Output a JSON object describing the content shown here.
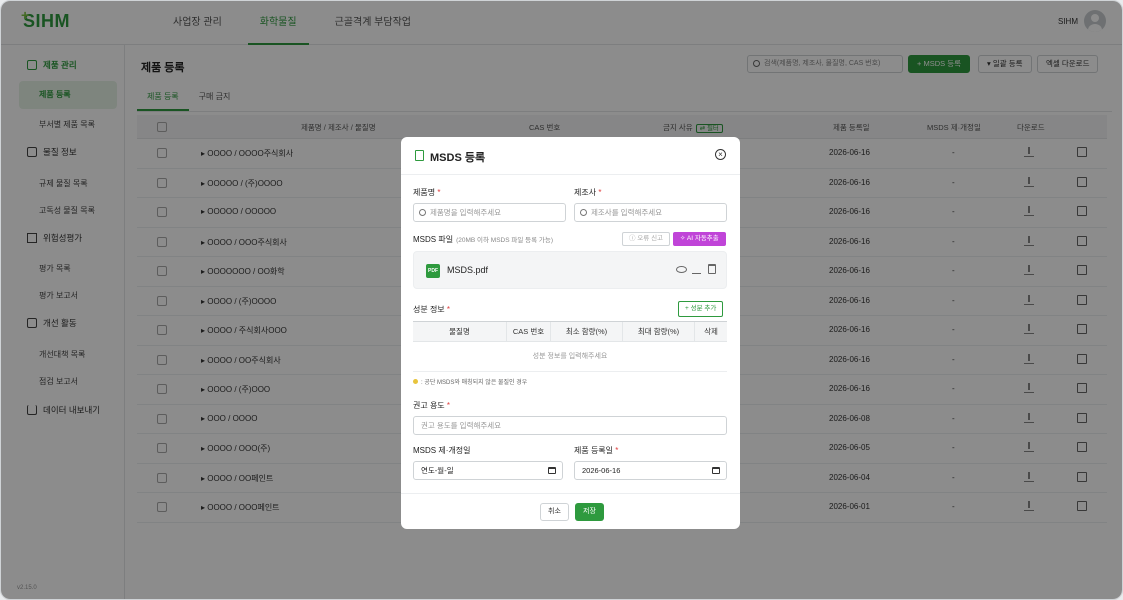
{
  "app": {
    "logo": "SIHM",
    "version": "v2.15.0"
  },
  "topnav": [
    "사업장 관리",
    "화학물질",
    "근골격계 부담작업"
  ],
  "user": {
    "name": "SIHM"
  },
  "sidebar": {
    "groups": [
      {
        "label": "제품 관리",
        "icon": "document-icon",
        "subs": [
          "제품 등록",
          "부서별 제품 목록"
        ]
      },
      {
        "label": "물질 정보",
        "icon": "search-document-icon",
        "subs": [
          "규제 물질 목록",
          "고독성 물질 목록"
        ]
      },
      {
        "label": "위험성평가",
        "icon": "warning-icon",
        "subs": [
          "평가 목록",
          "평가 보고서"
        ]
      },
      {
        "label": "개선 활동",
        "icon": "clipboard-icon",
        "subs": [
          "개선대책 목록",
          "점검 보고서"
        ]
      },
      {
        "label": "데이터 내보내기",
        "icon": "download-icon",
        "subs": []
      }
    ]
  },
  "main": {
    "title": "제품 등록",
    "search_placeholder": "검색(제품명, 제조사, 물질명, CAS 번호)",
    "btn_msds": "+ MSDS 등록",
    "btn_bulk": "▾ 일괄 등록",
    "btn_excel": "엑셀 다운로드",
    "tabs": [
      "제품 등록",
      "구매 금지"
    ],
    "columns": {
      "name": "제품명 / 제조사 / 물질명",
      "cas": "CAS 번호",
      "ban": "금지 사유",
      "filter": "⇄ 필터",
      "date": "제품 등록일",
      "msds": "MSDS 제·개정일",
      "download": "다운로드"
    },
    "rows": [
      {
        "name": "▸ OOOO / OOOO주식회사",
        "date": "2026-06-16",
        "msds": "-"
      },
      {
        "name": "▸ OOOOO / (주)OOOO",
        "date": "2026-06-16",
        "msds": "-"
      },
      {
        "name": "▸ OOOOO / OOOOO",
        "date": "2026-06-16",
        "msds": "-"
      },
      {
        "name": "▸ OOOO / OOO주식회사",
        "date": "2026-06-16",
        "msds": "-"
      },
      {
        "name": "▸ OOOOOOO / OO화학",
        "date": "2026-06-16",
        "msds": "-"
      },
      {
        "name": "▸ OOOO / (주)OOOO",
        "date": "2026-06-16",
        "msds": "-"
      },
      {
        "name": "▸ OOOO / 주식회사OOO",
        "date": "2026-06-16",
        "msds": "-"
      },
      {
        "name": "▸ OOOO / OO주식회사",
        "date": "2026-06-16",
        "msds": "-"
      },
      {
        "name": "▸ OOOO / (주)OOO",
        "date": "2026-06-16",
        "msds": "-"
      },
      {
        "name": "▸ OOO / OOOO",
        "date": "2026-06-08",
        "msds": "-"
      },
      {
        "name": "▸ OOOO / OOO(주)",
        "date": "2026-06-05",
        "msds": "-"
      },
      {
        "name": "▸ OOOO / OO페인트",
        "date": "2026-06-04",
        "msds": "-"
      },
      {
        "name": "▸ OOOO / OOO페인트",
        "date": "2026-06-01",
        "msds": "-"
      }
    ]
  },
  "modal": {
    "title": "MSDS 등록",
    "product_label": "제품명",
    "product_placeholder": "제품명을 입력해주세요",
    "maker_label": "제조사",
    "maker_placeholder": "제조사를 입력해주세요",
    "file_label": "MSDS 파일",
    "file_hint": "(20MB 이하 MSDS 파일 등록 가능)",
    "btn_error": "ⓘ 오류 신고",
    "btn_ai": "✧ AI 자동추출",
    "file_name": "MSDS.pdf",
    "pdf_badge": "PDF",
    "comp_label": "성분 정보",
    "btn_add_comp": "+ 성분 추가",
    "comp_cols": [
      "물질명",
      "CAS 번호",
      "최소 함량(%)",
      "최대 함량(%)",
      "삭제"
    ],
    "comp_empty": "성분 정보를 입력해주세요",
    "note": ": 공단 MSDS와 매칭되지 않은 물질인 경우",
    "usage_label": "권고 용도",
    "usage_placeholder": "권고 용도를 입력해주세요",
    "msds_date_label": "MSDS 제·개정일",
    "msds_date_value": "연도-월-일",
    "reg_date_label": "제품 등록일",
    "reg_date_value": "2026-06-16",
    "btn_cancel": "취소",
    "btn_save": "저장"
  }
}
